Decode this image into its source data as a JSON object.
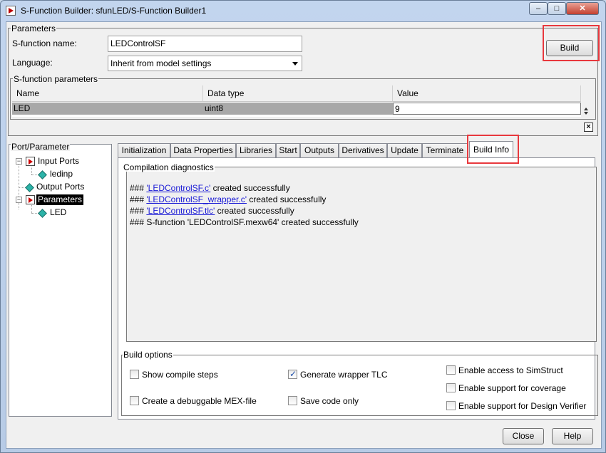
{
  "window": {
    "title": "S-Function Builder: sfunLED/S-Function Builder1",
    "controls": {
      "minimize": "–",
      "maximize": "□",
      "close": "✕"
    }
  },
  "parameters": {
    "group_label": "Parameters",
    "sfunction_name_label": "S-function name:",
    "sfunction_name_value": "LEDControlSF",
    "language_label": "Language:",
    "language_value": "Inherit from model settings",
    "build_button": "Build"
  },
  "sfunction_parameters": {
    "group_label": "S-function parameters",
    "columns": [
      "Name",
      "Data type",
      "Value"
    ],
    "rows": [
      {
        "name": "LED",
        "data_type": "uint8",
        "value": "9"
      }
    ]
  },
  "port_parameter": {
    "label": "Port/Parameter",
    "tree": [
      {
        "label": "Input Ports",
        "icon": "input-port-icon",
        "expanded": true
      },
      {
        "label": "ledinp",
        "icon": "port-diamond-icon"
      },
      {
        "label": "Output Ports",
        "icon": "port-diamond-icon"
      },
      {
        "label": "Parameters",
        "icon": "parameters-icon",
        "expanded": true,
        "selected": true
      },
      {
        "label": "LED",
        "icon": "port-diamond-icon"
      }
    ]
  },
  "tabs": [
    {
      "label": "Initialization"
    },
    {
      "label": "Data Properties"
    },
    {
      "label": "Libraries"
    },
    {
      "label": "Start"
    },
    {
      "label": "Outputs"
    },
    {
      "label": "Derivatives"
    },
    {
      "label": "Update"
    },
    {
      "label": "Terminate"
    },
    {
      "label": "Build Info",
      "active": true
    }
  ],
  "compilation": {
    "label": "Compilation diagnostics",
    "lines": [
      {
        "prefix": "### ",
        "link": "'LEDControlSF.c'",
        "suffix": " created successfully"
      },
      {
        "prefix": "### ",
        "link": "'LEDControlSF_wrapper.c'",
        "suffix": " created successfully"
      },
      {
        "prefix": "### ",
        "link": "'LEDControlSF.tlc'",
        "suffix": " created successfully"
      },
      {
        "prefix": "### S-function 'LEDControlSF.mexw64' created successfully",
        "link": "",
        "suffix": ""
      }
    ]
  },
  "build_options": {
    "label": "Build options",
    "items": [
      {
        "label": "Show compile steps",
        "checked": false
      },
      {
        "label": "Generate wrapper TLC",
        "checked": true
      },
      {
        "label": "Enable access to SimStruct",
        "checked": false
      },
      {
        "label": "Create a debuggable MEX-file",
        "checked": false
      },
      {
        "label": "Save code only",
        "checked": false
      },
      {
        "label": "Enable support for coverage",
        "checked": false
      },
      {
        "label": "Enable support for Design Verifier",
        "checked": false
      }
    ]
  },
  "footer": {
    "close_button": "Close",
    "help_button": "Help"
  },
  "colors": {
    "highlight_box": "#e8383d",
    "link": "#1a1ad6",
    "selection": "#000000"
  }
}
